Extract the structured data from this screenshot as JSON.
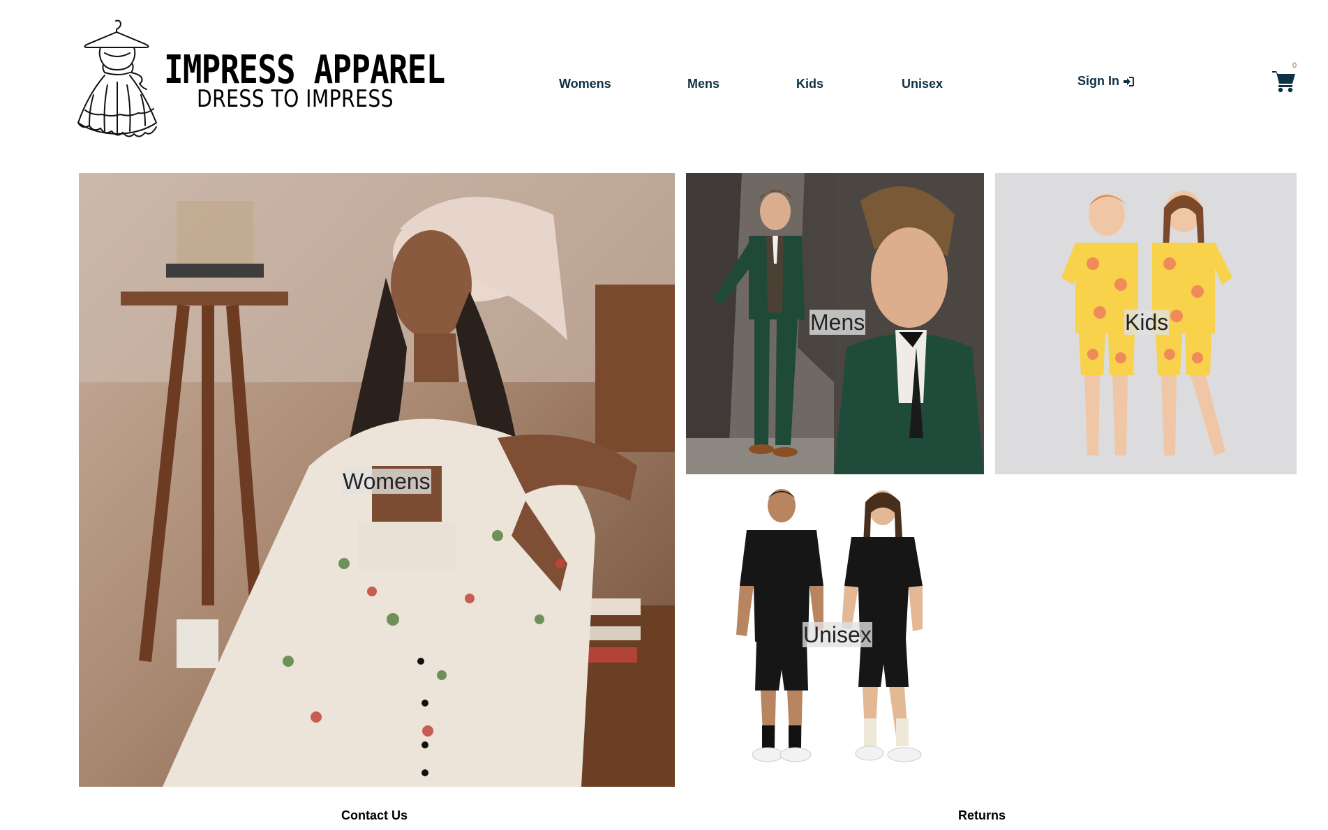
{
  "brand": {
    "name": "IMPRESS APPAREL",
    "tagline": "DRESS TO IMPRESS",
    "logo_icon": "dress-on-hanger-icon"
  },
  "nav": {
    "items": [
      {
        "label": "Womens"
      },
      {
        "label": "Mens"
      },
      {
        "label": "Kids"
      },
      {
        "label": "Unisex"
      }
    ],
    "sign_in": "Sign In",
    "sign_in_icon": "sign-in-icon",
    "cart_icon": "shopping-cart-icon",
    "cart_count": "0"
  },
  "tiles": {
    "womens": {
      "label": "Womens"
    },
    "mens": {
      "label": "Mens"
    },
    "kids": {
      "label": "Kids"
    },
    "unisex": {
      "label": "Unisex"
    }
  },
  "footer": {
    "contact": "Contact Us",
    "returns": "Returns"
  },
  "colors": {
    "nav_text": "#0d3144",
    "cart_badge": "#d9532c",
    "cart_icon": "#0d3144"
  }
}
